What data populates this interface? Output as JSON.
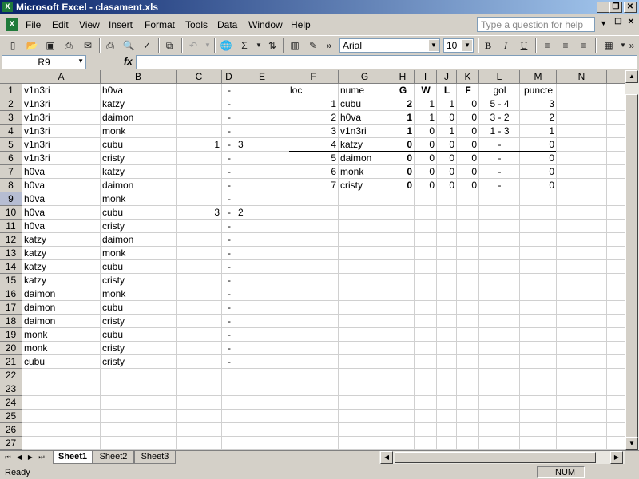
{
  "window": {
    "title": "Microsoft Excel - clasament.xls"
  },
  "menu": [
    "File",
    "Edit",
    "View",
    "Insert",
    "Format",
    "Tools",
    "Data",
    "Window",
    "Help"
  ],
  "help_placeholder": "Type a question for help",
  "toolbar": {
    "font": "Arial",
    "size": "10"
  },
  "formula_bar": {
    "cell_ref": "R9",
    "fx": "fx",
    "content": ""
  },
  "columns": [
    "A",
    "B",
    "C",
    "D",
    "E",
    "F",
    "G",
    "H",
    "I",
    "J",
    "K",
    "L",
    "M",
    "N"
  ],
  "rows": [
    "1",
    "2",
    "3",
    "4",
    "5",
    "6",
    "7",
    "8",
    "9",
    "10",
    "11",
    "12",
    "13",
    "14",
    "15",
    "16",
    "17",
    "18",
    "19",
    "20",
    "21",
    "22",
    "23",
    "24",
    "25",
    "26",
    "27"
  ],
  "selected_row": "9",
  "matches": [
    [
      "v1n3ri",
      "h0va",
      "",
      "-",
      ""
    ],
    [
      "v1n3ri",
      "katzy",
      "",
      "-",
      ""
    ],
    [
      "v1n3ri",
      "daimon",
      "",
      "-",
      ""
    ],
    [
      "v1n3ri",
      "monk",
      "",
      "-",
      ""
    ],
    [
      "v1n3ri",
      "cubu",
      "1",
      "-",
      "3"
    ],
    [
      "v1n3ri",
      "cristy",
      "",
      "-",
      ""
    ],
    [
      "h0va",
      "katzy",
      "",
      "-",
      ""
    ],
    [
      "h0va",
      "daimon",
      "",
      "-",
      ""
    ],
    [
      "h0va",
      "monk",
      "",
      "-",
      ""
    ],
    [
      "h0va",
      "cubu",
      "3",
      "-",
      "2"
    ],
    [
      "h0va",
      "cristy",
      "",
      "-",
      ""
    ],
    [
      "katzy",
      "daimon",
      "",
      "-",
      ""
    ],
    [
      "katzy",
      "monk",
      "",
      "-",
      ""
    ],
    [
      "katzy",
      "cubu",
      "",
      "-",
      ""
    ],
    [
      "katzy",
      "cristy",
      "",
      "-",
      ""
    ],
    [
      "daimon",
      "monk",
      "",
      "-",
      ""
    ],
    [
      "daimon",
      "cubu",
      "",
      "-",
      ""
    ],
    [
      "daimon",
      "cristy",
      "",
      "-",
      ""
    ],
    [
      "monk",
      "cubu",
      "",
      "-",
      ""
    ],
    [
      "monk",
      "cristy",
      "",
      "-",
      ""
    ],
    [
      "cubu",
      "cristy",
      "",
      "-",
      ""
    ]
  ],
  "standings_header": [
    "loc",
    "nume",
    "G",
    "W",
    "L",
    "F",
    "gol",
    "puncte"
  ],
  "standings": [
    [
      "1",
      "cubu",
      "2",
      "1",
      "1",
      "0",
      "5 - 4",
      "3"
    ],
    [
      "2",
      "h0va",
      "1",
      "1",
      "0",
      "0",
      "3 - 2",
      "2"
    ],
    [
      "3",
      "v1n3ri",
      "1",
      "0",
      "1",
      "0",
      "1 - 3",
      "1"
    ],
    [
      "4",
      "katzy",
      "0",
      "0",
      "0",
      "0",
      "-",
      "0"
    ],
    [
      "5",
      "daimon",
      "0",
      "0",
      "0",
      "0",
      "-",
      "0"
    ],
    [
      "6",
      "monk",
      "0",
      "0",
      "0",
      "0",
      "-",
      "0"
    ],
    [
      "7",
      "cristy",
      "0",
      "0",
      "0",
      "0",
      "-",
      "0"
    ]
  ],
  "sheets": [
    "Sheet1",
    "Sheet2",
    "Sheet3"
  ],
  "active_sheet": "Sheet1",
  "status": {
    "left": "Ready",
    "num": "NUM"
  }
}
